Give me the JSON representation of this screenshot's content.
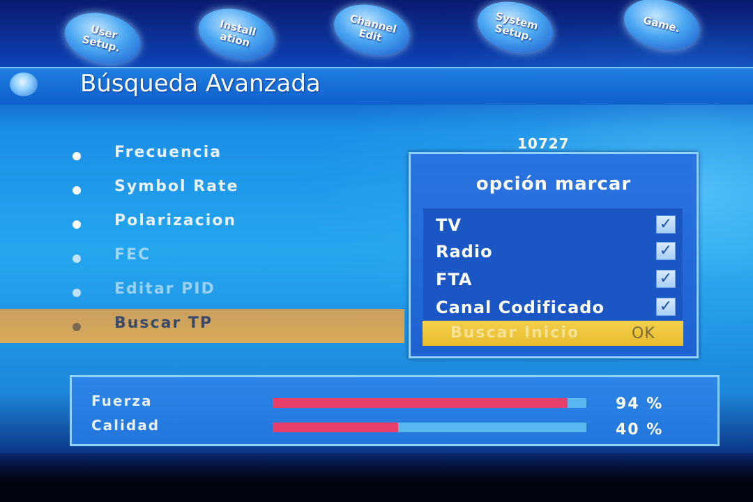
{
  "top_tabs": [
    {
      "line1": "User",
      "line2": "Setup."
    },
    {
      "line1": "Install",
      "line2": "ation"
    },
    {
      "line1": "Channel",
      "line2": "Edit"
    },
    {
      "line1": "System",
      "line2": "Setup."
    },
    {
      "line1": "Game.",
      "line2": ""
    }
  ],
  "page_title": "Búsqueda Avanzada",
  "menu_items": [
    {
      "label": "Frecuencia"
    },
    {
      "label": "Symbol Rate"
    },
    {
      "label": "Polarizacion"
    },
    {
      "label": "FEC"
    },
    {
      "label": "Editar PID"
    },
    {
      "label": "Buscar TP"
    }
  ],
  "frequency_value": "10727",
  "popup": {
    "title": "opción marcar",
    "options": [
      {
        "label": "TV",
        "checked": true
      },
      {
        "label": "Radio",
        "checked": true
      },
      {
        "label": "FTA",
        "checked": true
      },
      {
        "label": "Canal Codificado",
        "checked": true
      }
    ],
    "start_label": "Buscar Inicio",
    "ok_label": "OK"
  },
  "signal": {
    "strength_label": "Fuerza",
    "strength_value": 94,
    "strength_text": "94 %",
    "quality_label": "Calidad",
    "quality_value": 40,
    "quality_text": "40 %"
  },
  "colors": {
    "bar_fill": "#e8406a",
    "bar_track": "#5ab8f0",
    "selection": "#d8a958",
    "start_row": "#f2cf4a"
  }
}
